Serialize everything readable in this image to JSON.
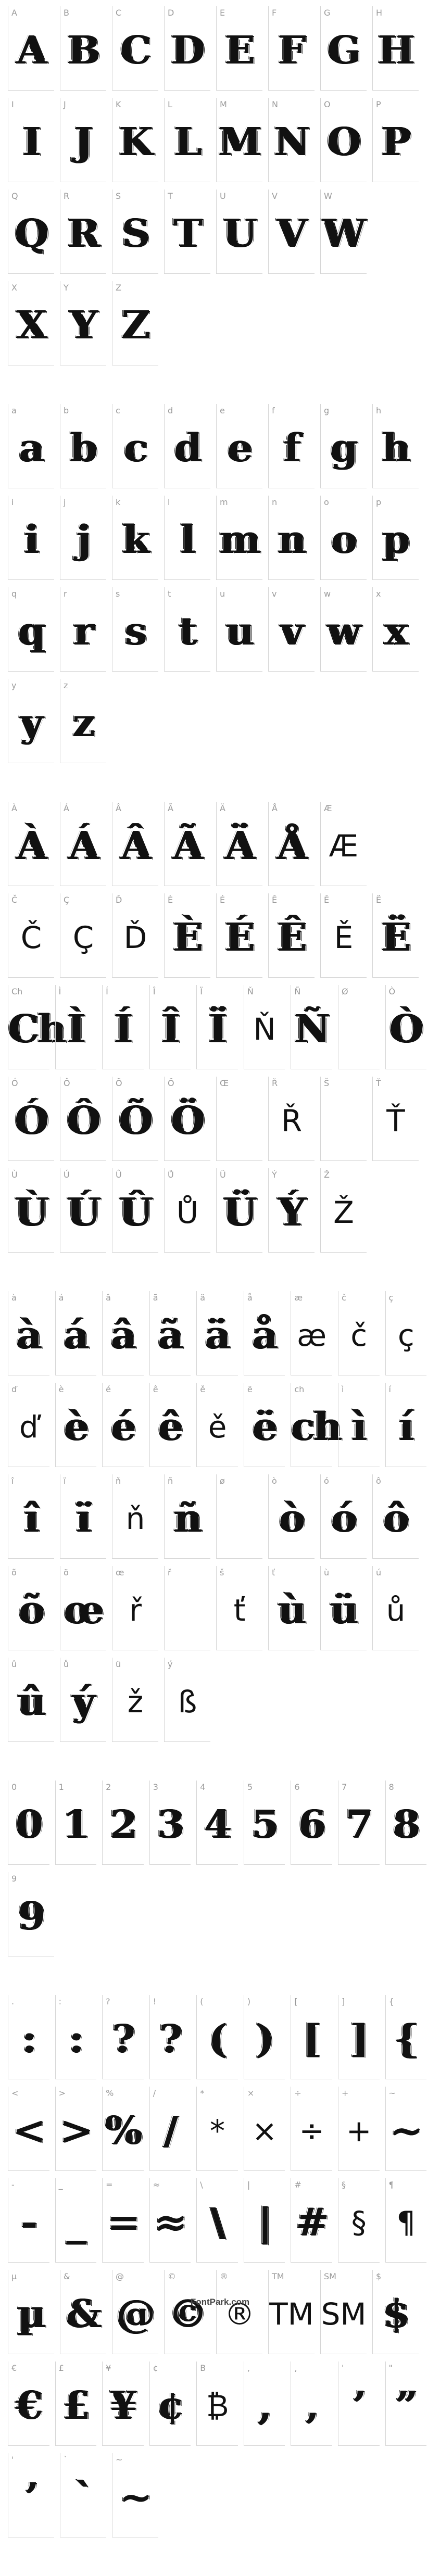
{
  "sections": [
    {
      "rows": [
        [
          {
            "l": "A",
            "g": "A"
          },
          {
            "l": "B",
            "g": "B"
          },
          {
            "l": "C",
            "g": "C"
          },
          {
            "l": "D",
            "g": "D"
          },
          {
            "l": "E",
            "g": "E"
          },
          {
            "l": "F",
            "g": "F"
          },
          {
            "l": "G",
            "g": "G"
          },
          {
            "l": "H",
            "g": "H"
          }
        ],
        [
          {
            "l": "I",
            "g": "I"
          },
          {
            "l": "J",
            "g": "J"
          },
          {
            "l": "K",
            "g": "K"
          },
          {
            "l": "L",
            "g": "L"
          },
          {
            "l": "M",
            "g": "M"
          },
          {
            "l": "N",
            "g": "N"
          },
          {
            "l": "O",
            "g": "O"
          },
          {
            "l": "P",
            "g": "P"
          }
        ],
        [
          {
            "l": "Q",
            "g": "Q"
          },
          {
            "l": "R",
            "g": "R"
          },
          {
            "l": "S",
            "g": "S"
          },
          {
            "l": "T",
            "g": "T"
          },
          {
            "l": "U",
            "g": "U"
          },
          {
            "l": "V",
            "g": "V"
          },
          {
            "l": "W",
            "g": "W"
          }
        ],
        [
          {
            "l": "X",
            "g": "X"
          },
          {
            "l": "Y",
            "g": "Y"
          },
          {
            "l": "Z",
            "g": "Z"
          }
        ]
      ]
    },
    {
      "rows": [
        [
          {
            "l": "a",
            "g": "a"
          },
          {
            "l": "b",
            "g": "b"
          },
          {
            "l": "c",
            "g": "c"
          },
          {
            "l": "d",
            "g": "d"
          },
          {
            "l": "e",
            "g": "e"
          },
          {
            "l": "f",
            "g": "f"
          },
          {
            "l": "g",
            "g": "g"
          },
          {
            "l": "h",
            "g": "h"
          }
        ],
        [
          {
            "l": "i",
            "g": "i"
          },
          {
            "l": "j",
            "g": "j"
          },
          {
            "l": "k",
            "g": "k"
          },
          {
            "l": "l",
            "g": "l"
          },
          {
            "l": "m",
            "g": "m"
          },
          {
            "l": "n",
            "g": "n"
          },
          {
            "l": "o",
            "g": "o"
          },
          {
            "l": "p",
            "g": "p"
          }
        ],
        [
          {
            "l": "q",
            "g": "q"
          },
          {
            "l": "r",
            "g": "r"
          },
          {
            "l": "s",
            "g": "s"
          },
          {
            "l": "t",
            "g": "t"
          },
          {
            "l": "u",
            "g": "u"
          },
          {
            "l": "v",
            "g": "v"
          },
          {
            "l": "w",
            "g": "w"
          },
          {
            "l": "x",
            "g": "x"
          }
        ],
        [
          {
            "l": "y",
            "g": "y"
          },
          {
            "l": "z",
            "g": "z"
          }
        ]
      ]
    },
    {
      "rows": [
        [
          {
            "l": "À",
            "g": "À"
          },
          {
            "l": "Á",
            "g": "Á"
          },
          {
            "l": "Â",
            "g": "Â"
          },
          {
            "l": "Ã",
            "g": "Ã"
          },
          {
            "l": "Ä",
            "g": "Ä"
          },
          {
            "l": "Å",
            "g": "Å"
          },
          {
            "l": "Æ",
            "g": "Æ",
            "p": 1
          }
        ],
        [
          {
            "l": "Č",
            "g": "Č",
            "p": 1
          },
          {
            "l": "Ç",
            "g": "Ç",
            "p": 1
          },
          {
            "l": "Ď",
            "g": "Ď",
            "p": 1
          },
          {
            "l": "È",
            "g": "È"
          },
          {
            "l": "É",
            "g": "É"
          },
          {
            "l": "Ê",
            "g": "Ê"
          },
          {
            "l": "Ě",
            "g": "Ě",
            "p": 1
          },
          {
            "l": "Ë",
            "g": "Ë"
          }
        ],
        [
          {
            "l": "Ch",
            "g": "Ch"
          },
          {
            "l": "Ì",
            "g": "Ì"
          },
          {
            "l": "Í",
            "g": "Í"
          },
          {
            "l": "Î",
            "g": "Î"
          },
          {
            "l": "Ï",
            "g": "Ï"
          },
          {
            "l": "Ň",
            "g": "Ň",
            "p": 1
          },
          {
            "l": "Ñ",
            "g": "Ñ"
          },
          {
            "l": "Ø",
            "g": ""
          },
          {
            "l": "Ò",
            "g": "Ò"
          }
        ],
        [
          {
            "l": "Ó",
            "g": "Ó"
          },
          {
            "l": "Ô",
            "g": "Ô"
          },
          {
            "l": "Õ",
            "g": "Õ"
          },
          {
            "l": "Ö",
            "g": "Ö"
          },
          {
            "l": "Œ",
            "g": ""
          },
          {
            "l": "Ř",
            "g": "Ř",
            "p": 1
          },
          {
            "l": "Š",
            "g": ""
          },
          {
            "l": "Ť",
            "g": "Ť",
            "p": 1
          }
        ],
        [
          {
            "l": "Ù",
            "g": "Ù"
          },
          {
            "l": "Ú",
            "g": "Ú"
          },
          {
            "l": "Û",
            "g": "Û"
          },
          {
            "l": "Ů",
            "g": "Ů",
            "p": 1
          },
          {
            "l": "Ü",
            "g": "Ü"
          },
          {
            "l": "Ý",
            "g": "Ý"
          },
          {
            "l": "Ž",
            "g": "Ž",
            "p": 1
          }
        ]
      ]
    },
    {
      "rows": [
        [
          {
            "l": "à",
            "g": "à"
          },
          {
            "l": "á",
            "g": "á"
          },
          {
            "l": "â",
            "g": "â"
          },
          {
            "l": "ã",
            "g": "ã"
          },
          {
            "l": "ä",
            "g": "ä"
          },
          {
            "l": "å",
            "g": "å"
          },
          {
            "l": "æ",
            "g": "æ",
            "p": 1
          },
          {
            "l": "č",
            "g": "č",
            "p": 1
          },
          {
            "l": "ç",
            "g": "ç",
            "p": 1
          }
        ],
        [
          {
            "l": "ď",
            "g": "ď",
            "p": 1
          },
          {
            "l": "è",
            "g": "è"
          },
          {
            "l": "é",
            "g": "é"
          },
          {
            "l": "ê",
            "g": "ê"
          },
          {
            "l": "ě",
            "g": "ě",
            "p": 1
          },
          {
            "l": "ë",
            "g": "ë"
          },
          {
            "l": "ch",
            "g": "ch"
          },
          {
            "l": "ì",
            "g": "ì"
          },
          {
            "l": "í",
            "g": "í"
          }
        ],
        [
          {
            "l": "î",
            "g": "î"
          },
          {
            "l": "ï",
            "g": "ï"
          },
          {
            "l": "ň",
            "g": "ň",
            "p": 1
          },
          {
            "l": "ñ",
            "g": "ñ"
          },
          {
            "l": "ø",
            "g": ""
          },
          {
            "l": "ò",
            "g": "ò"
          },
          {
            "l": "ó",
            "g": "ó"
          },
          {
            "l": "ô",
            "g": "ô"
          }
        ],
        [
          {
            "l": "õ",
            "g": "õ"
          },
          {
            "l": "ö",
            "g": "œ"
          },
          {
            "l": "œ",
            "g": "ř",
            "p": 1
          },
          {
            "l": "ř",
            "g": ""
          },
          {
            "l": "š",
            "g": "ť",
            "p": 1
          },
          {
            "l": "ť",
            "g": "ù"
          },
          {
            "l": "ù",
            "g": "ü"
          },
          {
            "l": "ú",
            "g": "ů",
            "p": 1
          }
        ],
        [
          {
            "l": "û",
            "g": "û"
          },
          {
            "l": "ů",
            "g": "ý"
          },
          {
            "l": "ü",
            "g": "ž",
            "p": 1
          },
          {
            "l": "ý",
            "g": "ß",
            "p": 1
          }
        ]
      ]
    },
    {
      "rows": [
        [
          {
            "l": "0",
            "g": "0"
          },
          {
            "l": "1",
            "g": "1"
          },
          {
            "l": "2",
            "g": "2"
          },
          {
            "l": "3",
            "g": "3"
          },
          {
            "l": "4",
            "g": "4"
          },
          {
            "l": "5",
            "g": "5"
          },
          {
            "l": "6",
            "g": "6"
          },
          {
            "l": "7",
            "g": "7"
          },
          {
            "l": "8",
            "g": "8"
          }
        ],
        [
          {
            "l": "9",
            "g": "9"
          }
        ]
      ]
    },
    {
      "rows": [
        [
          {
            "l": ".",
            "g": ":"
          },
          {
            "l": ":",
            "g": ":"
          },
          {
            "l": "?",
            "g": "?"
          },
          {
            "l": "!",
            "g": "?"
          },
          {
            "l": "(",
            "g": "("
          },
          {
            "l": ")",
            "g": ")"
          },
          {
            "l": "[",
            "g": "["
          },
          {
            "l": "]",
            "g": "]"
          },
          {
            "l": "{",
            "g": "{"
          }
        ],
        [
          {
            "l": "<",
            "g": "<"
          },
          {
            "l": ">",
            "g": ">"
          },
          {
            "l": "%",
            "g": "%"
          },
          {
            "l": "/",
            "g": "/"
          },
          {
            "l": "*",
            "g": "*",
            "p": 1
          },
          {
            "l": "×",
            "g": "×",
            "p": 1
          },
          {
            "l": "÷",
            "g": "÷",
            "p": 1
          },
          {
            "l": "+",
            "g": "+",
            "p": 1
          },
          {
            "l": "~",
            "g": "~"
          }
        ],
        [
          {
            "l": "-",
            "g": "-"
          },
          {
            "l": "_",
            "g": "_"
          },
          {
            "l": "=",
            "g": "="
          },
          {
            "l": "≈",
            "g": "≈"
          },
          {
            "l": "\\",
            "g": "\\"
          },
          {
            "l": "|",
            "g": "|"
          },
          {
            "l": "#",
            "g": "#"
          },
          {
            "l": "§",
            "g": "§",
            "p": 1
          },
          {
            "l": "¶",
            "g": "¶",
            "p": 1
          }
        ],
        [
          {
            "l": "µ",
            "g": "µ"
          },
          {
            "l": "&",
            "g": "&"
          },
          {
            "l": "@",
            "g": "@"
          },
          {
            "l": "©",
            "g": "©"
          },
          {
            "l": "®",
            "g": "®",
            "p": 1
          },
          {
            "l": "TM",
            "g": "TM",
            "p": 1
          },
          {
            "l": "SM",
            "g": "SM",
            "p": 1
          },
          {
            "l": "$",
            "g": "$"
          }
        ],
        [
          {
            "l": "€",
            "g": "€"
          },
          {
            "l": "£",
            "g": "£"
          },
          {
            "l": "¥",
            "g": "¥"
          },
          {
            "l": "¢",
            "g": "¢"
          },
          {
            "l": "B",
            "g": "₿",
            "p": 1
          },
          {
            "l": ",",
            "g": ","
          },
          {
            "l": "‚",
            "g": "‚"
          },
          {
            "l": "'",
            "g": "’"
          },
          {
            "l": "\"",
            "g": "”"
          }
        ],
        [
          {
            "l": "'",
            "g": "’"
          },
          {
            "l": "`",
            "g": "`"
          },
          {
            "l": "~",
            "g": "~"
          }
        ]
      ]
    }
  ],
  "footer": "FontPark.com"
}
